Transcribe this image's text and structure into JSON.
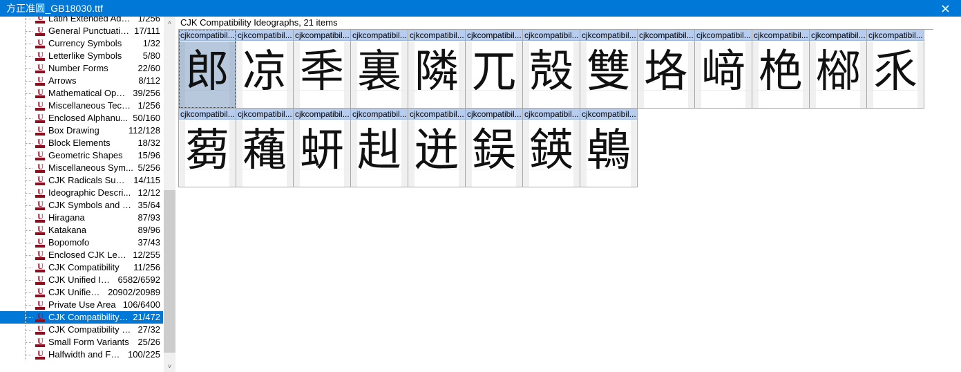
{
  "titlebar": {
    "title": "方正准圆_GB18030.ttf",
    "close_label": "close-icon"
  },
  "tree": {
    "scroll": {
      "up_arrow": "˄",
      "down_arrow": "˅"
    },
    "items": [
      {
        "label": "Latin Extended Addi...",
        "count": "1/256",
        "selected": false
      },
      {
        "label": "General Punctuation",
        "count": "17/111",
        "selected": false
      },
      {
        "label": "Currency Symbols",
        "count": "1/32",
        "selected": false
      },
      {
        "label": "Letterlike Symbols",
        "count": "5/80",
        "selected": false
      },
      {
        "label": "Number Forms",
        "count": "22/60",
        "selected": false
      },
      {
        "label": "Arrows",
        "count": "8/112",
        "selected": false
      },
      {
        "label": "Mathematical Ope...",
        "count": "39/256",
        "selected": false
      },
      {
        "label": "Miscellaneous Tech...",
        "count": "1/256",
        "selected": false
      },
      {
        "label": "Enclosed Alphanu...",
        "count": "50/160",
        "selected": false
      },
      {
        "label": "Box Drawing",
        "count": "112/128",
        "selected": false
      },
      {
        "label": "Block Elements",
        "count": "18/32",
        "selected": false
      },
      {
        "label": "Geometric Shapes",
        "count": "15/96",
        "selected": false
      },
      {
        "label": "Miscellaneous Sym...",
        "count": "5/256",
        "selected": false
      },
      {
        "label": "CJK Radicals Suppl...",
        "count": "14/115",
        "selected": false
      },
      {
        "label": "Ideographic Descri...",
        "count": "12/12",
        "selected": false
      },
      {
        "label": "CJK Symbols and P...",
        "count": "35/64",
        "selected": false
      },
      {
        "label": "Hiragana",
        "count": "87/93",
        "selected": false
      },
      {
        "label": "Katakana",
        "count": "89/96",
        "selected": false
      },
      {
        "label": "Bopomofo",
        "count": "37/43",
        "selected": false
      },
      {
        "label": "Enclosed CJK Lette...",
        "count": "12/255",
        "selected": false
      },
      {
        "label": "CJK Compatibility",
        "count": "11/256",
        "selected": false
      },
      {
        "label": "CJK Unified Ide...",
        "count": "6582/6592",
        "selected": false
      },
      {
        "label": "CJK Unified I...",
        "count": "20902/20989",
        "selected": false
      },
      {
        "label": "Private Use Area",
        "count": "106/6400",
        "selected": false
      },
      {
        "label": "CJK Compatibility I...",
        "count": "21/472",
        "selected": true
      },
      {
        "label": "CJK Compatibility F...",
        "count": "27/32",
        "selected": false
      },
      {
        "label": "Small Form Variants",
        "count": "25/26",
        "selected": false
      },
      {
        "label": "Halfwidth and Full...",
        "count": "100/225",
        "selected": false
      }
    ]
  },
  "glyphs": {
    "header": "CJK Compatibility Ideographs, 21 items",
    "cell_caption": "cjkcompatibil...",
    "cells": [
      {
        "char": "郎",
        "selected": true
      },
      {
        "char": "凉",
        "selected": false
      },
      {
        "char": "秊",
        "selected": false
      },
      {
        "char": "裏",
        "selected": false
      },
      {
        "char": "隣",
        "selected": false
      },
      {
        "char": "兀",
        "selected": false
      },
      {
        "char": "殻",
        "selected": false
      },
      {
        "char": "雙",
        "selected": false
      },
      {
        "char": "垎",
        "selected": false
      },
      {
        "char": "﨑",
        "selected": false
      },
      {
        "char": "栬",
        "selected": false
      },
      {
        "char": "㮝",
        "selected": false
      },
      {
        "char": "乑",
        "selected": false
      },
      {
        "char": "蒭",
        "selected": false
      },
      {
        "char": "蘒",
        "selected": false
      },
      {
        "char": "蚈",
        "selected": false
      },
      {
        "char": "赳",
        "selected": false
      },
      {
        "char": "迸",
        "selected": false
      },
      {
        "char": "鋘",
        "selected": false
      },
      {
        "char": "鍈",
        "selected": false
      },
      {
        "char": "鵫",
        "selected": false
      }
    ]
  },
  "colors": {
    "titlebar": "#0078d7",
    "selection": "#0078d7",
    "cell_caption_bg": "#b6cdf0",
    "cell_selected_bg": "#b8c8dc",
    "icon_red": "#c00020"
  }
}
